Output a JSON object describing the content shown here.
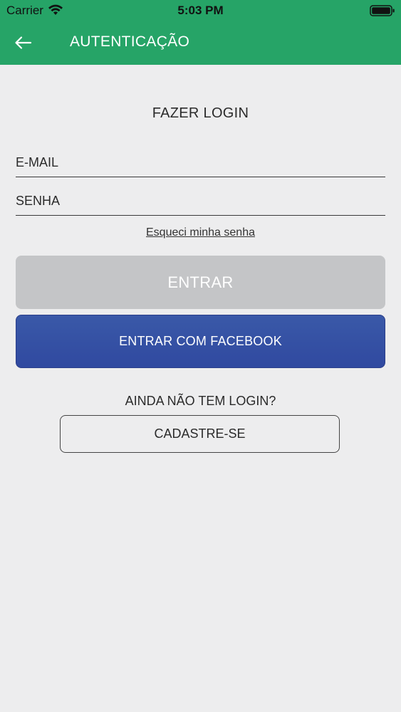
{
  "status_bar": {
    "carrier": "Carrier",
    "time": "5:03 PM",
    "wifi_icon": "wifi-icon",
    "battery_icon": "battery-full-icon"
  },
  "app_bar": {
    "title": "AUTENTICAÇÃO",
    "back_icon": "arrow-left-icon",
    "background_color": "#26a467"
  },
  "login": {
    "heading": "FAZER LOGIN",
    "email_placeholder": "E-MAIL",
    "email_value": "",
    "password_placeholder": "SENHA",
    "password_value": "",
    "forgot_password": "Esqueci minha senha",
    "enter_button": "ENTRAR",
    "enter_button_color": "#c4c5c7",
    "facebook_button": "ENTRAR COM FACEBOOK",
    "facebook_button_color": "#3551a4"
  },
  "register": {
    "prompt": "AINDA NÃO TEM LOGIN?",
    "button": "CADASTRE-SE"
  }
}
